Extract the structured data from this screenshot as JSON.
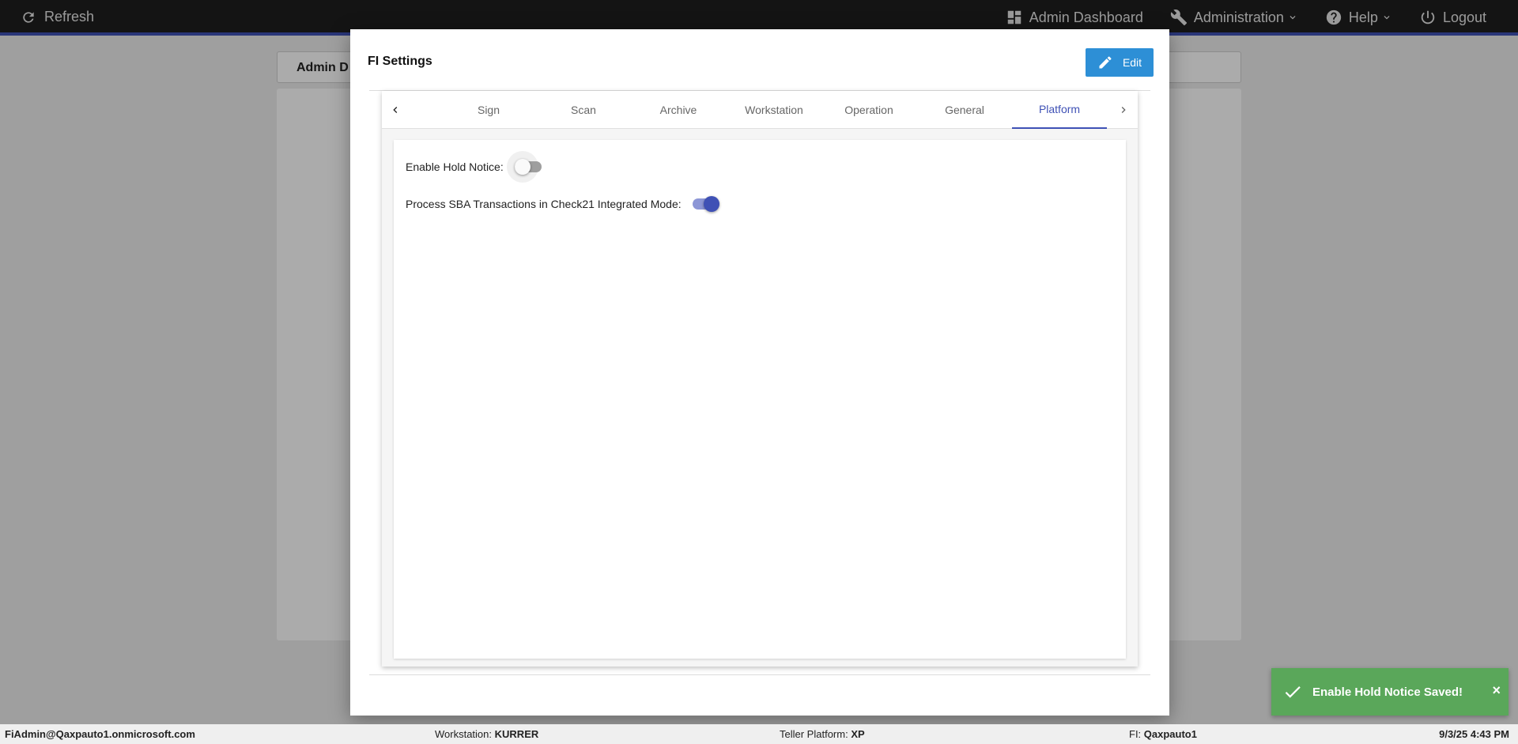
{
  "topbar": {
    "refresh_label": "Refresh",
    "admin_dashboard_label": "Admin Dashboard",
    "administration_label": "Administration",
    "help_label": "Help",
    "logout_label": "Logout"
  },
  "background": {
    "tab_label": "Admin D"
  },
  "modal": {
    "title": "FI Settings",
    "edit_label": "Edit",
    "tabs": [
      "Sign",
      "Scan",
      "Archive",
      "Workstation",
      "Operation",
      "General",
      "Platform"
    ],
    "active_tab": "Platform",
    "settings": [
      {
        "label": "Enable Hold Notice:",
        "enabled": false
      },
      {
        "label": "Process SBA Transactions in Check21 Integrated Mode:",
        "enabled": true
      }
    ]
  },
  "toast": {
    "message": "Enable Hold Notice Saved!",
    "close": "×"
  },
  "statusbar": {
    "user": "FiAdmin@Qaxpauto1.onmicrosoft.com",
    "workstation_label": "Workstation:",
    "workstation_value": "KURRER",
    "platform_label": "Teller Platform:",
    "platform_value": "XP",
    "fi_label": "FI:",
    "fi_value": "Qaxpauto1",
    "datetime": "9/3/25 4:43 PM"
  },
  "colors": {
    "accent": "#3f51b5",
    "edit_button": "#2d8fd6",
    "toast": "#5aa75a",
    "topbar": "#1e1e1e"
  }
}
